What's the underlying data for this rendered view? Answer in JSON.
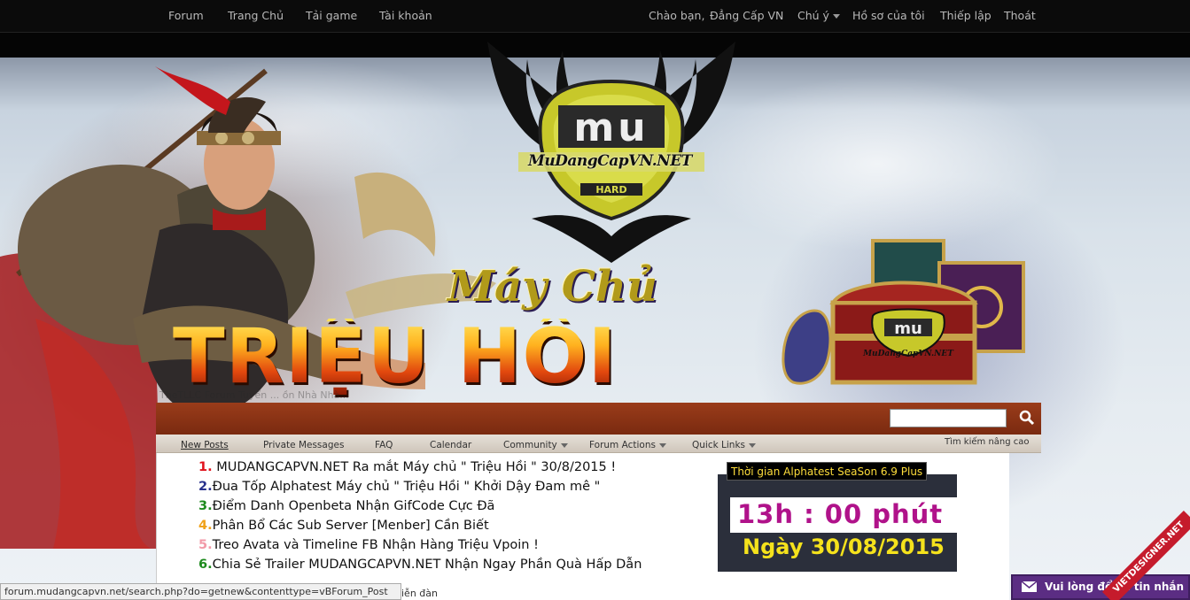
{
  "topbar": {
    "nav": [
      "Forum",
      "Trang Chủ",
      "Tải game",
      "Tài khoản"
    ],
    "greeting": "Chào bạn,",
    "username": "Đẳng Cấp VN",
    "notices": "Chú ý",
    "profile": "Hồ sơ của tôi",
    "settings": "Thiếp lập",
    "logout": "Thoát"
  },
  "banner": {
    "logo_text": "MuDangCapVN.NET",
    "logo_sub": "HARD",
    "subtitle": "Máy Chủ",
    "title": "TRIỆU HỔI",
    "chest_logo": "MuDangCapVN.NET",
    "ghost_text": "TheTLLC Forum Tuyển ... ồn Nhà Nhà..."
  },
  "navbar": {
    "tabs": [
      "New Posts",
      "Private Messages",
      "FAQ",
      "Calendar",
      "Community",
      "Forum Actions",
      "Quick Links"
    ],
    "advanced_search": "Tìm kiếm nâng cao",
    "search_placeholder": ""
  },
  "news": {
    "items": [
      {
        "num": "1.",
        "text": " MUDANGCAPVN.NET Ra mắt Máy chủ \" Triệu Hồi \" 30/8/2015 !",
        "color": "#e0121c"
      },
      {
        "num": "2.",
        "text": "Đua Tốp Alphatest Máy chủ \" Triệu Hồi \" Khởi Dậy Đam mê \"",
        "color": "#27308c"
      },
      {
        "num": "3.",
        "text": "Điểm Danh Openbeta Nhận GifCode Cực Đã",
        "color": "#1d8a1d"
      },
      {
        "num": "4.",
        "text": "Phân Bổ Các Sub Server [Menber] Cần Biết",
        "color": "#f0a21a"
      },
      {
        "num": "5.",
        "text": "Treo Avata và Timeline FB Nhận Hàng Triệu Vpoin !",
        "color": "#f29aa8"
      },
      {
        "num": "6.",
        "text": "Chia Sẻ Trailer MUDANGCAPVN.NET Nhận Ngay Phần Quà Hấp Dẫn",
        "color": "#1d8a1d"
      }
    ]
  },
  "countdown": {
    "title": "Thời gian Alphatest SeaSon 6.9 Plus",
    "time": "13h : 00  phút",
    "date": "Ngày 30/08/2015"
  },
  "status": {
    "url": "forum.mudangcapvn.net/search.php?do=getnew&contenttype=vBForum_Post",
    "trailing": "iễn đàn"
  },
  "chat": {
    "label": "Vui lòng để lại tin nhắn",
    "ribbon": "VIETDESIGNER.NET"
  }
}
